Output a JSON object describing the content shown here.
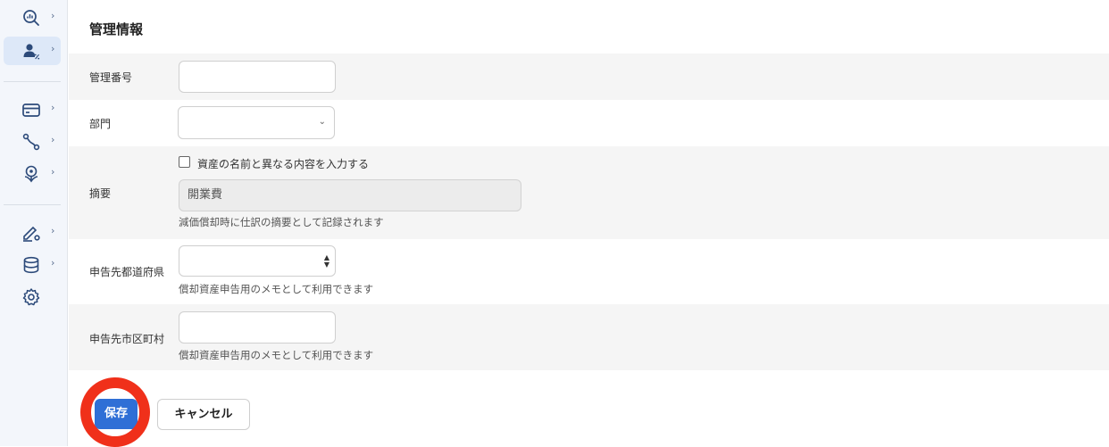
{
  "sidebar": {
    "items": [
      {
        "icon": "analytics-search-icon",
        "chevron": "›"
      },
      {
        "icon": "user-percent-icon",
        "chevron": "›",
        "active": true
      },
      {
        "icon": "credit-card-icon",
        "chevron": "›"
      },
      {
        "icon": "route-icon",
        "chevron": "›"
      },
      {
        "icon": "plant-badge-icon",
        "chevron": "›"
      },
      {
        "icon": "sign-gear-icon",
        "chevron": "›"
      },
      {
        "icon": "database-icon",
        "chevron": "›"
      },
      {
        "icon": "settings-gear-icon"
      }
    ]
  },
  "section": {
    "title": "管理情報"
  },
  "fields": {
    "management_number": {
      "label": "管理番号",
      "value": ""
    },
    "department": {
      "label": "部門",
      "value": ""
    },
    "summary": {
      "label": "摘要",
      "checkbox_label": "資産の名前と異なる内容を入力する",
      "checked": false,
      "value": "開業費",
      "help": "減価償却時に仕訳の摘要として記録されます"
    },
    "prefecture": {
      "label": "申告先都道府県",
      "value": "",
      "help": "償却資産申告用のメモとして利用できます"
    },
    "city": {
      "label": "申告先市区町村",
      "value": "",
      "help": "償却資産申告用のメモとして利用できます"
    }
  },
  "actions": {
    "save_label": "保存",
    "cancel_label": "キャンセル"
  },
  "colors": {
    "primary": "#2f6fd6",
    "highlight": "#f0301a",
    "row_alt": "#f5f5f5",
    "sidebar_bg": "#f3f6fb",
    "sidebar_active": "#dde8f8"
  }
}
